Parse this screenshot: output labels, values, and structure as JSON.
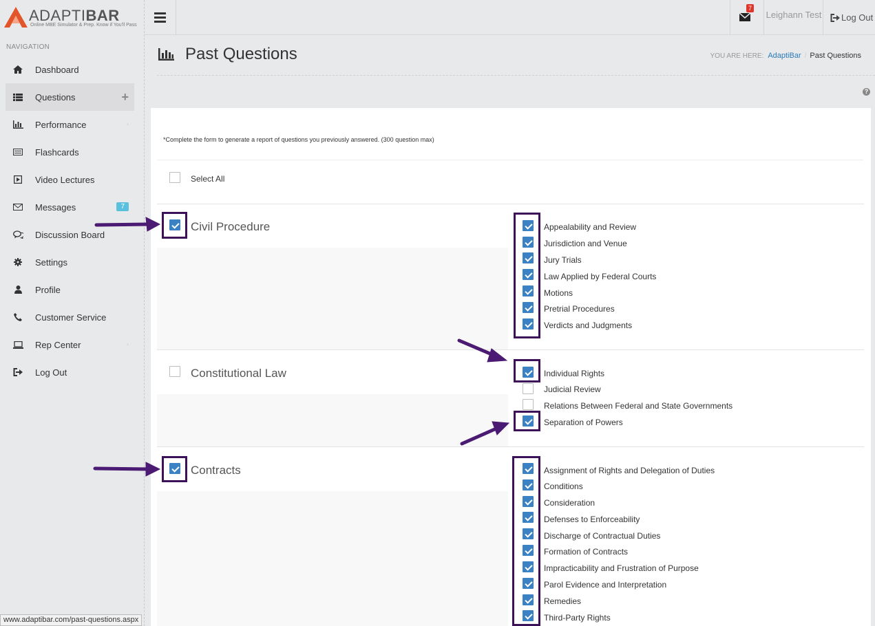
{
  "app": {
    "logo_text": "ADAPTIBAR",
    "logo_tagline": "Online MBE Simulator & Prep. Know if You'll Pass"
  },
  "sidebar": {
    "nav_label": "NAVIGATION",
    "items": [
      {
        "label": "Dashboard",
        "icon": "home-icon"
      },
      {
        "label": "Questions",
        "icon": "list-icon"
      },
      {
        "label": "Performance",
        "icon": "bar-chart-icon"
      },
      {
        "label": "Flashcards",
        "icon": "card-icon"
      },
      {
        "label": "Video Lectures",
        "icon": "play-icon"
      },
      {
        "label": "Messages",
        "icon": "envelope-icon",
        "badge": "7"
      },
      {
        "label": "Discussion Board",
        "icon": "chat-icon"
      },
      {
        "label": "Settings",
        "icon": "gear-icon"
      },
      {
        "label": "Profile",
        "icon": "user-icon"
      },
      {
        "label": "Customer Service",
        "icon": "phone-icon"
      },
      {
        "label": "Rep Center",
        "icon": "laptop-icon"
      },
      {
        "label": "Log Out",
        "icon": "logout-icon"
      }
    ]
  },
  "topbar": {
    "mail_badge": "7",
    "user_name": "Leighann Test",
    "logout_label": "Log Out"
  },
  "header": {
    "title": "Past Questions",
    "breadcrumb_prefix": "YOU ARE HERE:",
    "breadcrumb_link": "AdaptiBar",
    "breadcrumb_current": "Past Questions"
  },
  "form": {
    "note": "*Complete the form to generate a report of questions you previously answered. (300 question max)",
    "select_all_label": "Select All",
    "subjects": [
      {
        "name": "Civil Procedure",
        "checked": true,
        "topics": [
          {
            "label": "Appealability and Review",
            "checked": true
          },
          {
            "label": "Jurisdiction and Venue",
            "checked": true
          },
          {
            "label": "Jury Trials",
            "checked": true
          },
          {
            "label": "Law Applied by Federal Courts",
            "checked": true
          },
          {
            "label": "Motions",
            "checked": true
          },
          {
            "label": "Pretrial Procedures",
            "checked": true
          },
          {
            "label": "Verdicts and Judgments",
            "checked": true
          }
        ]
      },
      {
        "name": "Constitutional Law",
        "checked": false,
        "topics": [
          {
            "label": "Individual Rights",
            "checked": true
          },
          {
            "label": "Judicial Review",
            "checked": false
          },
          {
            "label": "Relations Between Federal and State Governments",
            "checked": false
          },
          {
            "label": "Separation of Powers",
            "checked": true
          }
        ]
      },
      {
        "name": "Contracts",
        "checked": true,
        "topics": [
          {
            "label": "Assignment of Rights and Delegation of Duties",
            "checked": true
          },
          {
            "label": "Conditions",
            "checked": true
          },
          {
            "label": "Consideration",
            "checked": true
          },
          {
            "label": "Defenses to Enforceability",
            "checked": true
          },
          {
            "label": "Discharge of Contractual Duties",
            "checked": true
          },
          {
            "label": "Formation of Contracts",
            "checked": true
          },
          {
            "label": "Impracticability and Frustration of Purpose",
            "checked": true
          },
          {
            "label": "Parol Evidence and Interpretation",
            "checked": true
          },
          {
            "label": "Remedies",
            "checked": true
          },
          {
            "label": "Third-Party Rights",
            "checked": true
          }
        ]
      }
    ]
  },
  "annotations": {
    "highlight_color": "#3d1158",
    "arrow_color": "#4b1a72"
  },
  "status_bar": {
    "url": "www.adaptibar.com/past-questions.aspx"
  }
}
